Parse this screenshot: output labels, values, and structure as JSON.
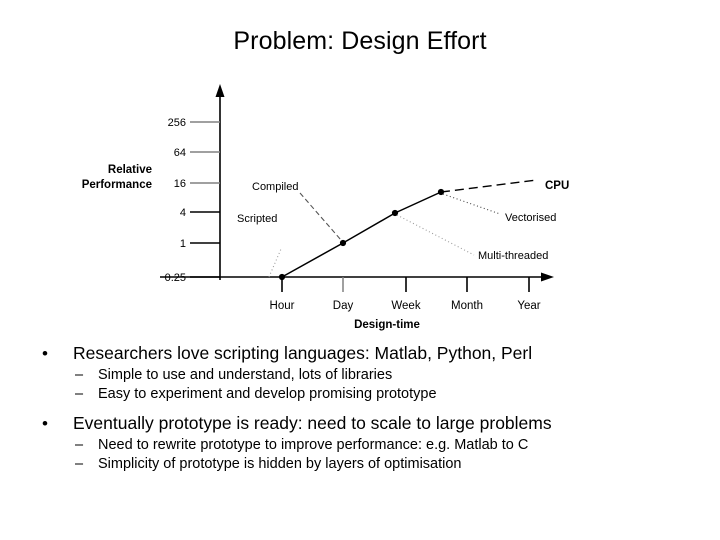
{
  "slide": {
    "title": "Problem: Design Effort"
  },
  "chart_data": {
    "type": "line",
    "title": "",
    "xlabel": "Design-time",
    "ylabel": "Relative Performance",
    "categories": [
      "Hour",
      "Day",
      "Week",
      "Month",
      "Year"
    ],
    "ytick_labels": [
      "256",
      "64",
      "16",
      "4",
      "1",
      "0.25"
    ],
    "ylim": [
      0.25,
      512
    ],
    "grid": false,
    "legend": "none",
    "series": [
      {
        "name": "Relative Performance",
        "x": [
          "Hour",
          "Day",
          "Week",
          "Month"
        ],
        "values": [
          0.25,
          1,
          4,
          10
        ]
      },
      {
        "name": "CPU projection",
        "style": "dashed",
        "x": [
          "Month",
          "Year"
        ],
        "values": [
          10,
          16
        ]
      }
    ],
    "annotations": [
      {
        "text": "Scripted",
        "bold": false,
        "points_to": "Hour",
        "leader": "dotted"
      },
      {
        "text": "Compiled",
        "bold": false,
        "points_to": "Day",
        "leader": "dashed"
      },
      {
        "text": "CPU",
        "bold": true,
        "points_to": "Year",
        "leader": "dashed"
      },
      {
        "text": "Vectorised",
        "bold": false,
        "points_to": "Month",
        "leader": "dotted"
      },
      {
        "text": "Multi-threaded",
        "bold": false,
        "points_to": "Week",
        "leader": "dotted"
      }
    ],
    "point_labels": {
      "hour": "Hour",
      "day": "Day",
      "week": "Week",
      "month": "Month",
      "year": "Year"
    },
    "colors": {
      "line": "#000000",
      "axis": "#000000",
      "tick_major": "#000000",
      "tick_minor": "#808080"
    }
  },
  "body": {
    "groups": [
      {
        "bullet": "•",
        "text": "Researchers love scripting languages: Matlab, Python, Perl",
        "subs": [
          {
            "dash": "–",
            "text": "Simple to use and understand, lots of libraries"
          },
          {
            "dash": "–",
            "text": "Easy to experiment and develop promising prototype"
          }
        ]
      },
      {
        "bullet": "•",
        "text": "Eventually prototype is ready: need to scale to large problems",
        "subs": [
          {
            "dash": "–",
            "text": "Need to rewrite prototype to improve performance: e.g. Matlab to C"
          },
          {
            "dash": "–",
            "text": "Simplicity of prototype is hidden by layers of optimisation"
          }
        ]
      }
    ]
  }
}
